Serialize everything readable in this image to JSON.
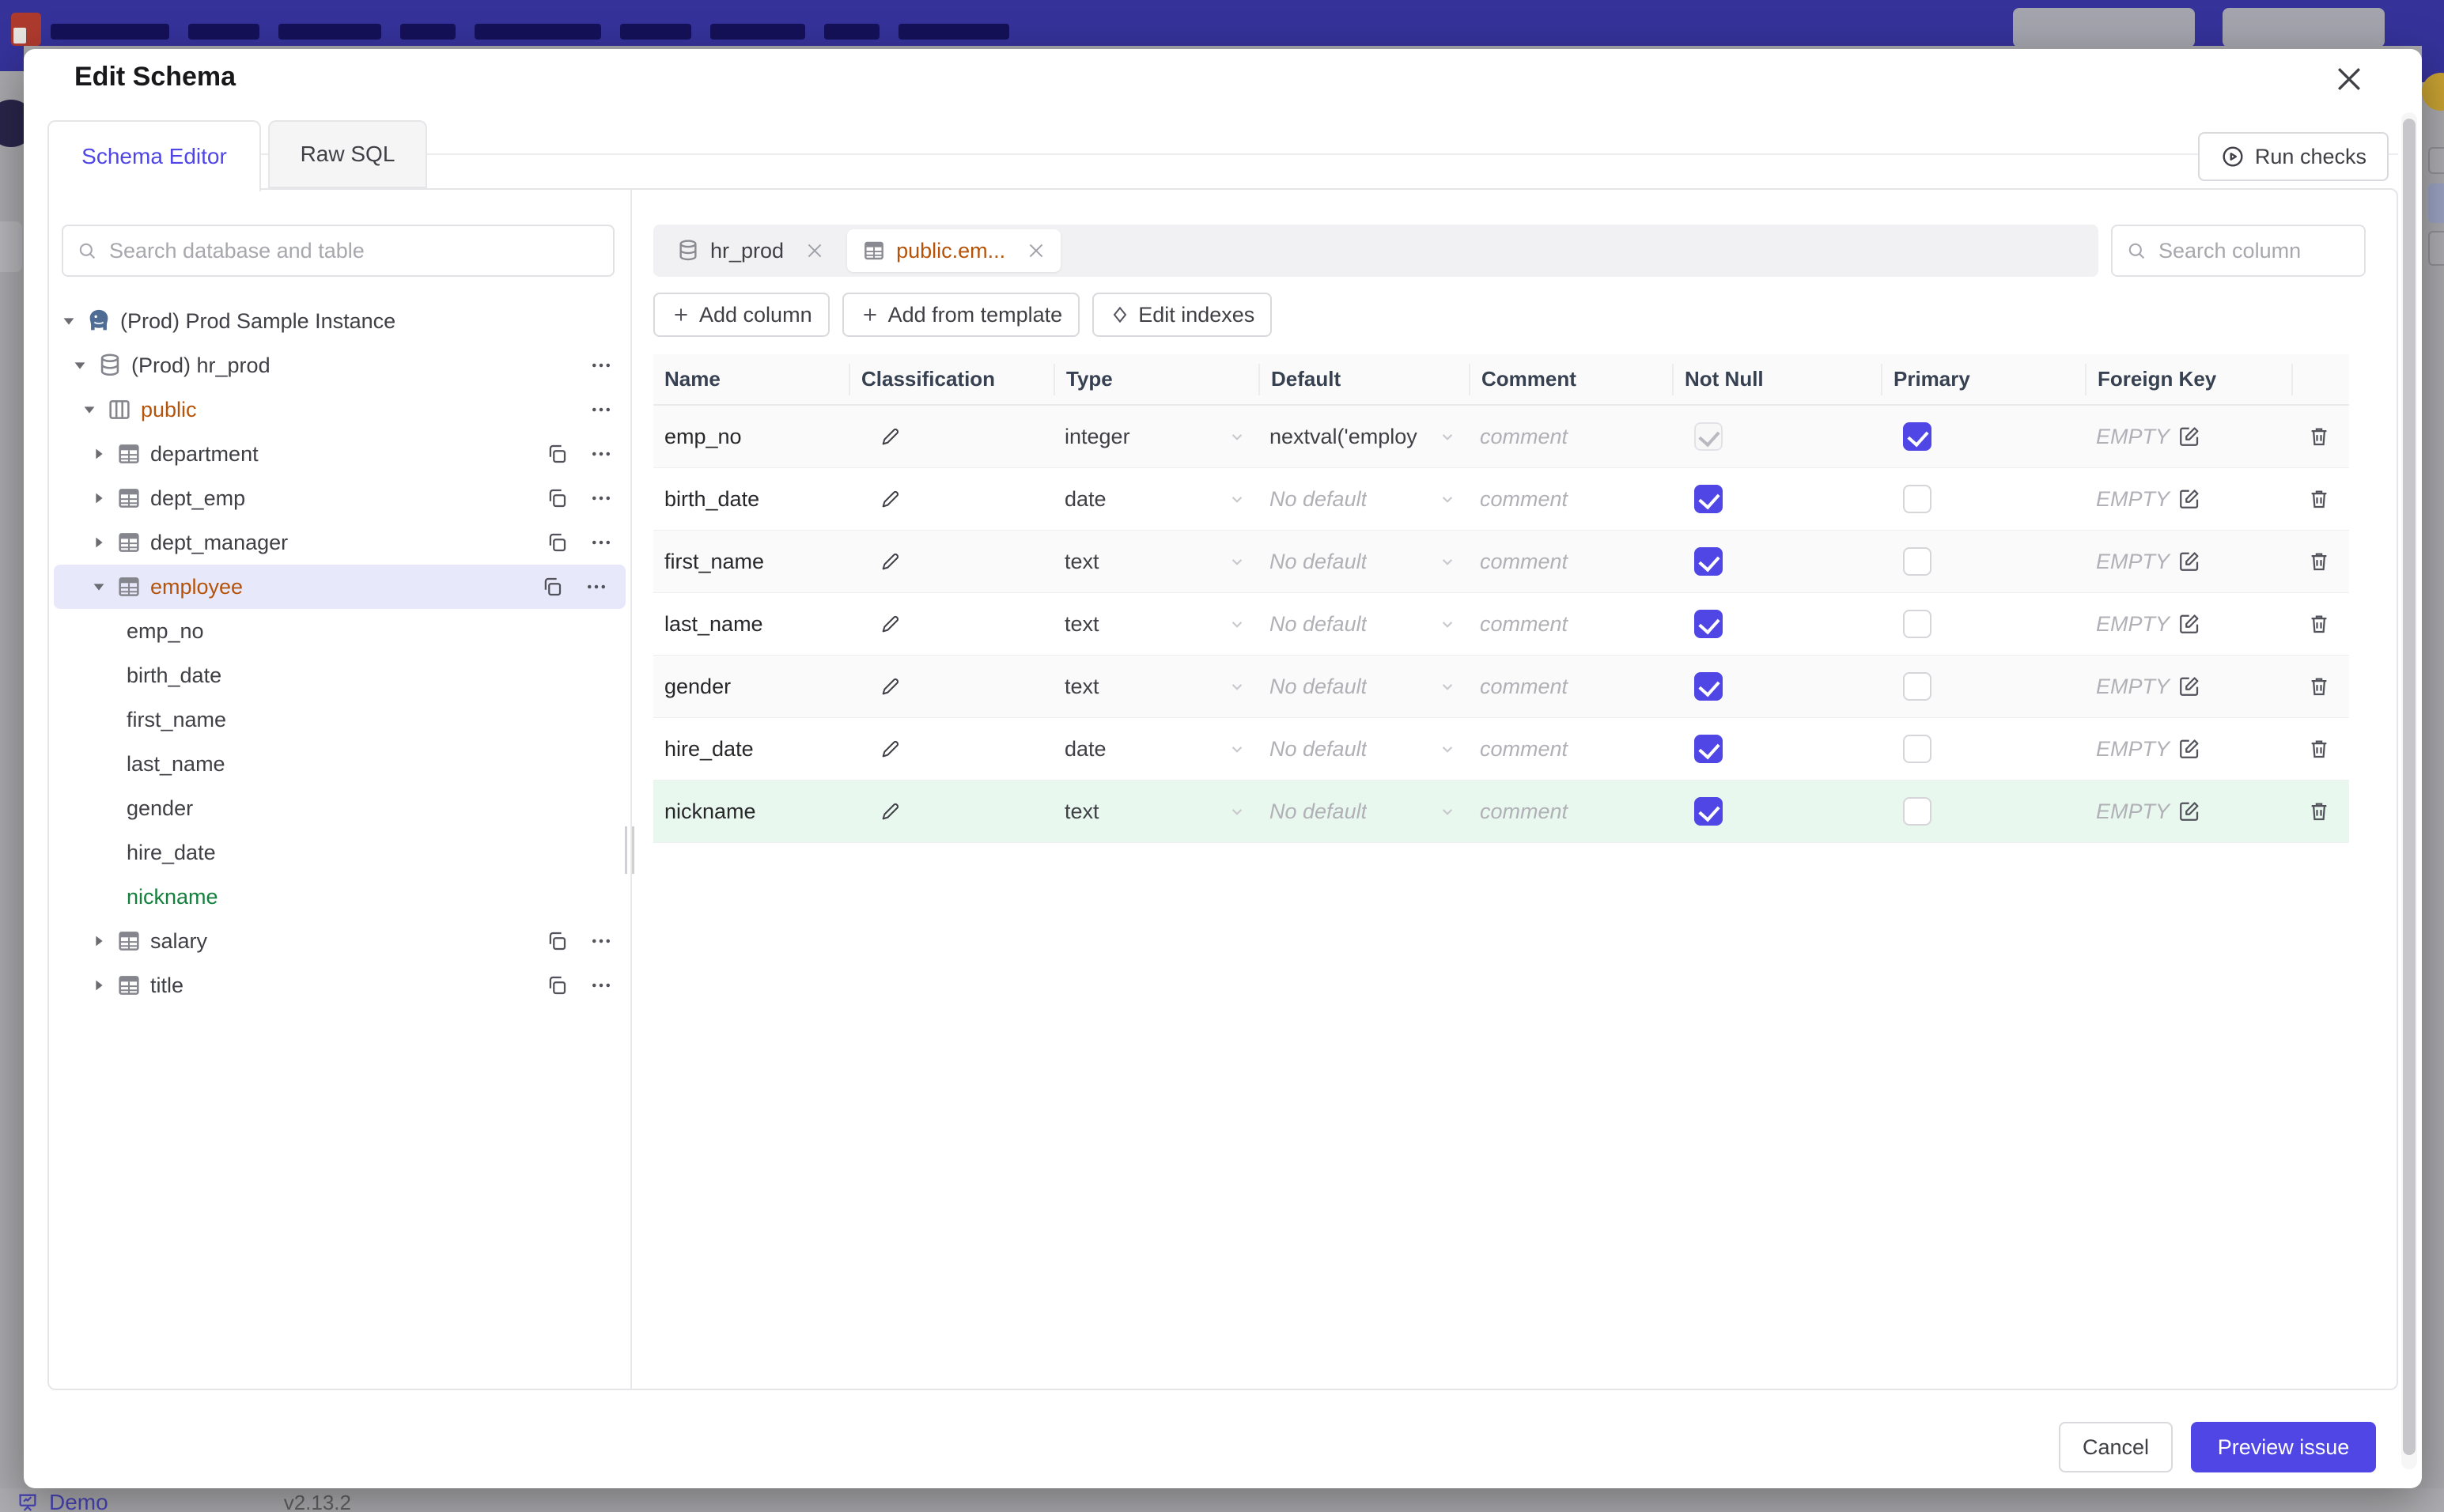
{
  "colors": {
    "accent": "#4f46e5",
    "amber_text": "#b45309",
    "green_text": "#15803d",
    "navbar": "#35329a",
    "new_row_bg": "#e9f8ef",
    "selected_row_bg": "#e8e8fb"
  },
  "backdrop": {
    "demo_label": "Demo",
    "version": "v2.13.2"
  },
  "modal": {
    "title": "Edit Schema",
    "run_checks": "Run checks"
  },
  "tabs": {
    "schema_editor": "Schema Editor",
    "raw_sql": "Raw SQL"
  },
  "sidebar": {
    "search_placeholder": "Search database and table",
    "tree": [
      {
        "label": "(Prod) Prod Sample Instance",
        "type": "instance"
      },
      {
        "label": "(Prod) hr_prod",
        "type": "database"
      },
      {
        "label": "public",
        "type": "schema"
      },
      {
        "label": "department",
        "type": "table"
      },
      {
        "label": "dept_emp",
        "type": "table"
      },
      {
        "label": "dept_manager",
        "type": "table"
      },
      {
        "label": "employee",
        "type": "table"
      },
      {
        "label": "emp_no",
        "type": "column"
      },
      {
        "label": "birth_date",
        "type": "column"
      },
      {
        "label": "first_name",
        "type": "column"
      },
      {
        "label": "last_name",
        "type": "column"
      },
      {
        "label": "gender",
        "type": "column"
      },
      {
        "label": "hire_date",
        "type": "column"
      },
      {
        "label": "nickname",
        "type": "column"
      },
      {
        "label": "salary",
        "type": "table"
      },
      {
        "label": "title",
        "type": "table"
      }
    ]
  },
  "editor": {
    "chips": [
      {
        "label": "hr_prod"
      },
      {
        "label": "public.em..."
      }
    ],
    "add_column": "Add column",
    "add_from_template": "Add from template",
    "edit_indexes": "Edit indexes",
    "search_placeholder": "Search column"
  },
  "table": {
    "headers": [
      "Name",
      "Classification",
      "Type",
      "Default",
      "Comment",
      "Not Null",
      "Primary",
      "Foreign Key"
    ],
    "comment_placeholder": "comment",
    "fk_empty": "EMPTY",
    "rows": [
      {
        "name": "emp_no",
        "type": "integer",
        "default": "nextval('employ",
        "default_muted": "no",
        "not_null": "on-disabled",
        "primary": "on",
        "row_state": "default"
      },
      {
        "name": "birth_date",
        "type": "date",
        "default": "No default",
        "default_muted": "yes",
        "not_null": "on",
        "primary": "off",
        "row_state": "default"
      },
      {
        "name": "first_name",
        "type": "text",
        "default": "No default",
        "default_muted": "yes",
        "not_null": "on",
        "primary": "off",
        "row_state": "default"
      },
      {
        "name": "last_name",
        "type": "text",
        "default": "No default",
        "default_muted": "yes",
        "not_null": "on",
        "primary": "off",
        "row_state": "default"
      },
      {
        "name": "gender",
        "type": "text",
        "default": "No default",
        "default_muted": "yes",
        "not_null": "on",
        "primary": "off",
        "row_state": "default"
      },
      {
        "name": "hire_date",
        "type": "date",
        "default": "No default",
        "default_muted": "yes",
        "not_null": "on",
        "primary": "off",
        "row_state": "default"
      },
      {
        "name": "nickname",
        "type": "text",
        "default": "No default",
        "default_muted": "yes",
        "not_null": "on",
        "primary": "off",
        "row_state": "new"
      }
    ]
  },
  "footer": {
    "cancel": "Cancel",
    "preview": "Preview issue"
  }
}
